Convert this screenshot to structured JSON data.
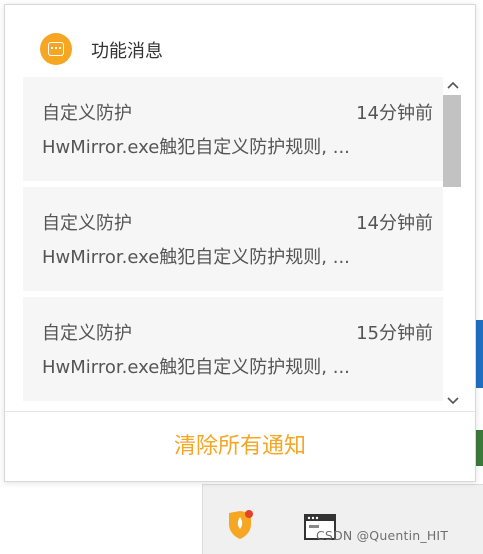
{
  "panel": {
    "title": "功能消息",
    "icon": "message-icon",
    "accent_color": "#f5a623"
  },
  "notifications": [
    {
      "category": "自定义防护",
      "time": "14分钟前",
      "message": "HwMirror.exe触犯自定义防护规则, ..."
    },
    {
      "category": "自定义防护",
      "time": "14分钟前",
      "message": "HwMirror.exe触犯自定义防护规则, ..."
    },
    {
      "category": "自定义防护",
      "time": "15分钟前",
      "message": "HwMirror.exe触犯自定义防护规则, ..."
    }
  ],
  "footer": {
    "clear_label": "清除所有通知"
  },
  "taskbar": {
    "tray_icons": [
      "shield-icon",
      "window-icon"
    ],
    "watermark": "CSDN @Quentin_HIT"
  }
}
